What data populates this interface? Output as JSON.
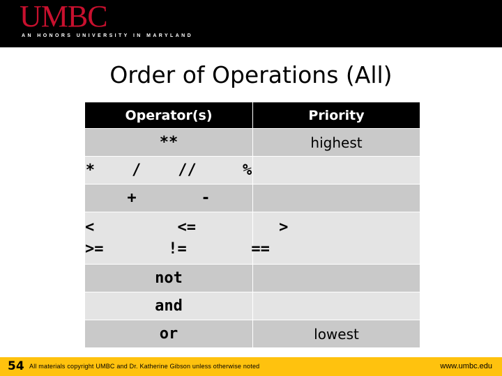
{
  "header": {
    "logo_wordmark": "UMBC",
    "logo_tagline": "AN HONORS UNIVERSITY IN MARYLAND",
    "band_color": "#000000",
    "logo_color": "#c8102e"
  },
  "title": "Order of Operations (All)",
  "table": {
    "columns": [
      "Operator(s)",
      "Priority"
    ],
    "rows": [
      {
        "operators": [
          "**"
        ],
        "priority": "highest",
        "shade": "dark"
      },
      {
        "operators": [
          "*    /    //     %"
        ],
        "priority": "",
        "shade": "light"
      },
      {
        "operators": [
          "+       -"
        ],
        "priority": "",
        "shade": "dark"
      },
      {
        "operators": [
          "<         <=         >",
          ">=       !=       =="
        ],
        "priority": "",
        "shade": "light"
      },
      {
        "operators": [
          "not"
        ],
        "priority": "",
        "shade": "dark"
      },
      {
        "operators": [
          "and"
        ],
        "priority": "",
        "shade": "light"
      },
      {
        "operators": [
          "or"
        ],
        "priority": "lowest",
        "shade": "dark"
      }
    ],
    "header_bg": "#000000",
    "header_fg": "#ffffff",
    "row_dark_bg": "#c9c9c9",
    "row_light_bg": "#e4e4e4"
  },
  "footer": {
    "slide_number": "54",
    "credit": "All materials copyright UMBC and Dr. Katherine Gibson unless otherwise noted",
    "url": "www.umbc.edu",
    "bar_color": "#ffc20e"
  }
}
